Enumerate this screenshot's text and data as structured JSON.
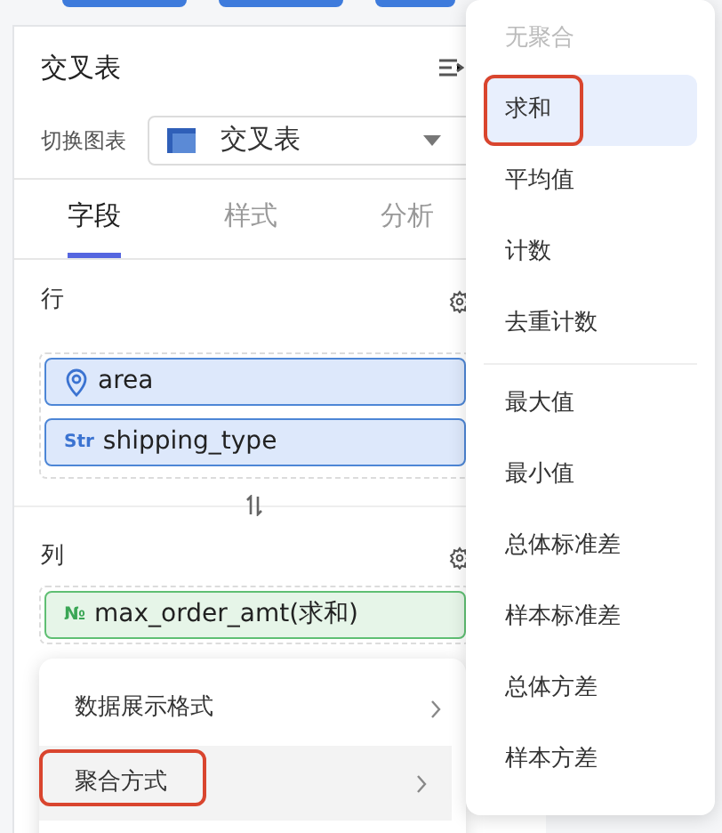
{
  "panel": {
    "title": "交叉表",
    "switch_label": "切换图表",
    "chart_type": "交叉表"
  },
  "tabs": [
    {
      "label": "字段",
      "selected": true
    },
    {
      "label": "样式",
      "selected": false
    },
    {
      "label": "分析",
      "selected": false
    }
  ],
  "rows_section": {
    "label": "行",
    "fields": [
      {
        "kind": "geo",
        "name": "area"
      },
      {
        "kind": "string",
        "type_mark": "Str",
        "name": "shipping_type"
      }
    ]
  },
  "columns_section": {
    "label": "列",
    "fields": [
      {
        "kind": "number",
        "type_mark": "№",
        "name": "max_order_amt(求和)"
      }
    ]
  },
  "context_menu": [
    {
      "label": "数据展示格式",
      "selected": false,
      "outlined": false
    },
    {
      "label": "聚合方式",
      "selected": true,
      "outlined": true
    }
  ],
  "aggregation_menu": [
    {
      "label": "无聚合",
      "disabled": true,
      "selected": false,
      "outlined": false
    },
    {
      "label": "求和",
      "disabled": false,
      "selected": true,
      "outlined": true
    },
    {
      "label": "平均值",
      "disabled": false,
      "selected": false,
      "outlined": false
    },
    {
      "label": "计数",
      "disabled": false,
      "selected": false,
      "outlined": false
    },
    {
      "label": "去重计数",
      "disabled": false,
      "selected": false,
      "outlined": false,
      "divider_after": true
    },
    {
      "label": "最大值",
      "disabled": false,
      "selected": false,
      "outlined": false
    },
    {
      "label": "最小值",
      "disabled": false,
      "selected": false,
      "outlined": false
    },
    {
      "label": "总体标准差",
      "disabled": false,
      "selected": false,
      "outlined": false
    },
    {
      "label": "样本标准差",
      "disabled": false,
      "selected": false,
      "outlined": false
    },
    {
      "label": "总体方差",
      "disabled": false,
      "selected": false,
      "outlined": false
    },
    {
      "label": "样本方差",
      "disabled": false,
      "selected": false,
      "outlined": false
    }
  ]
}
